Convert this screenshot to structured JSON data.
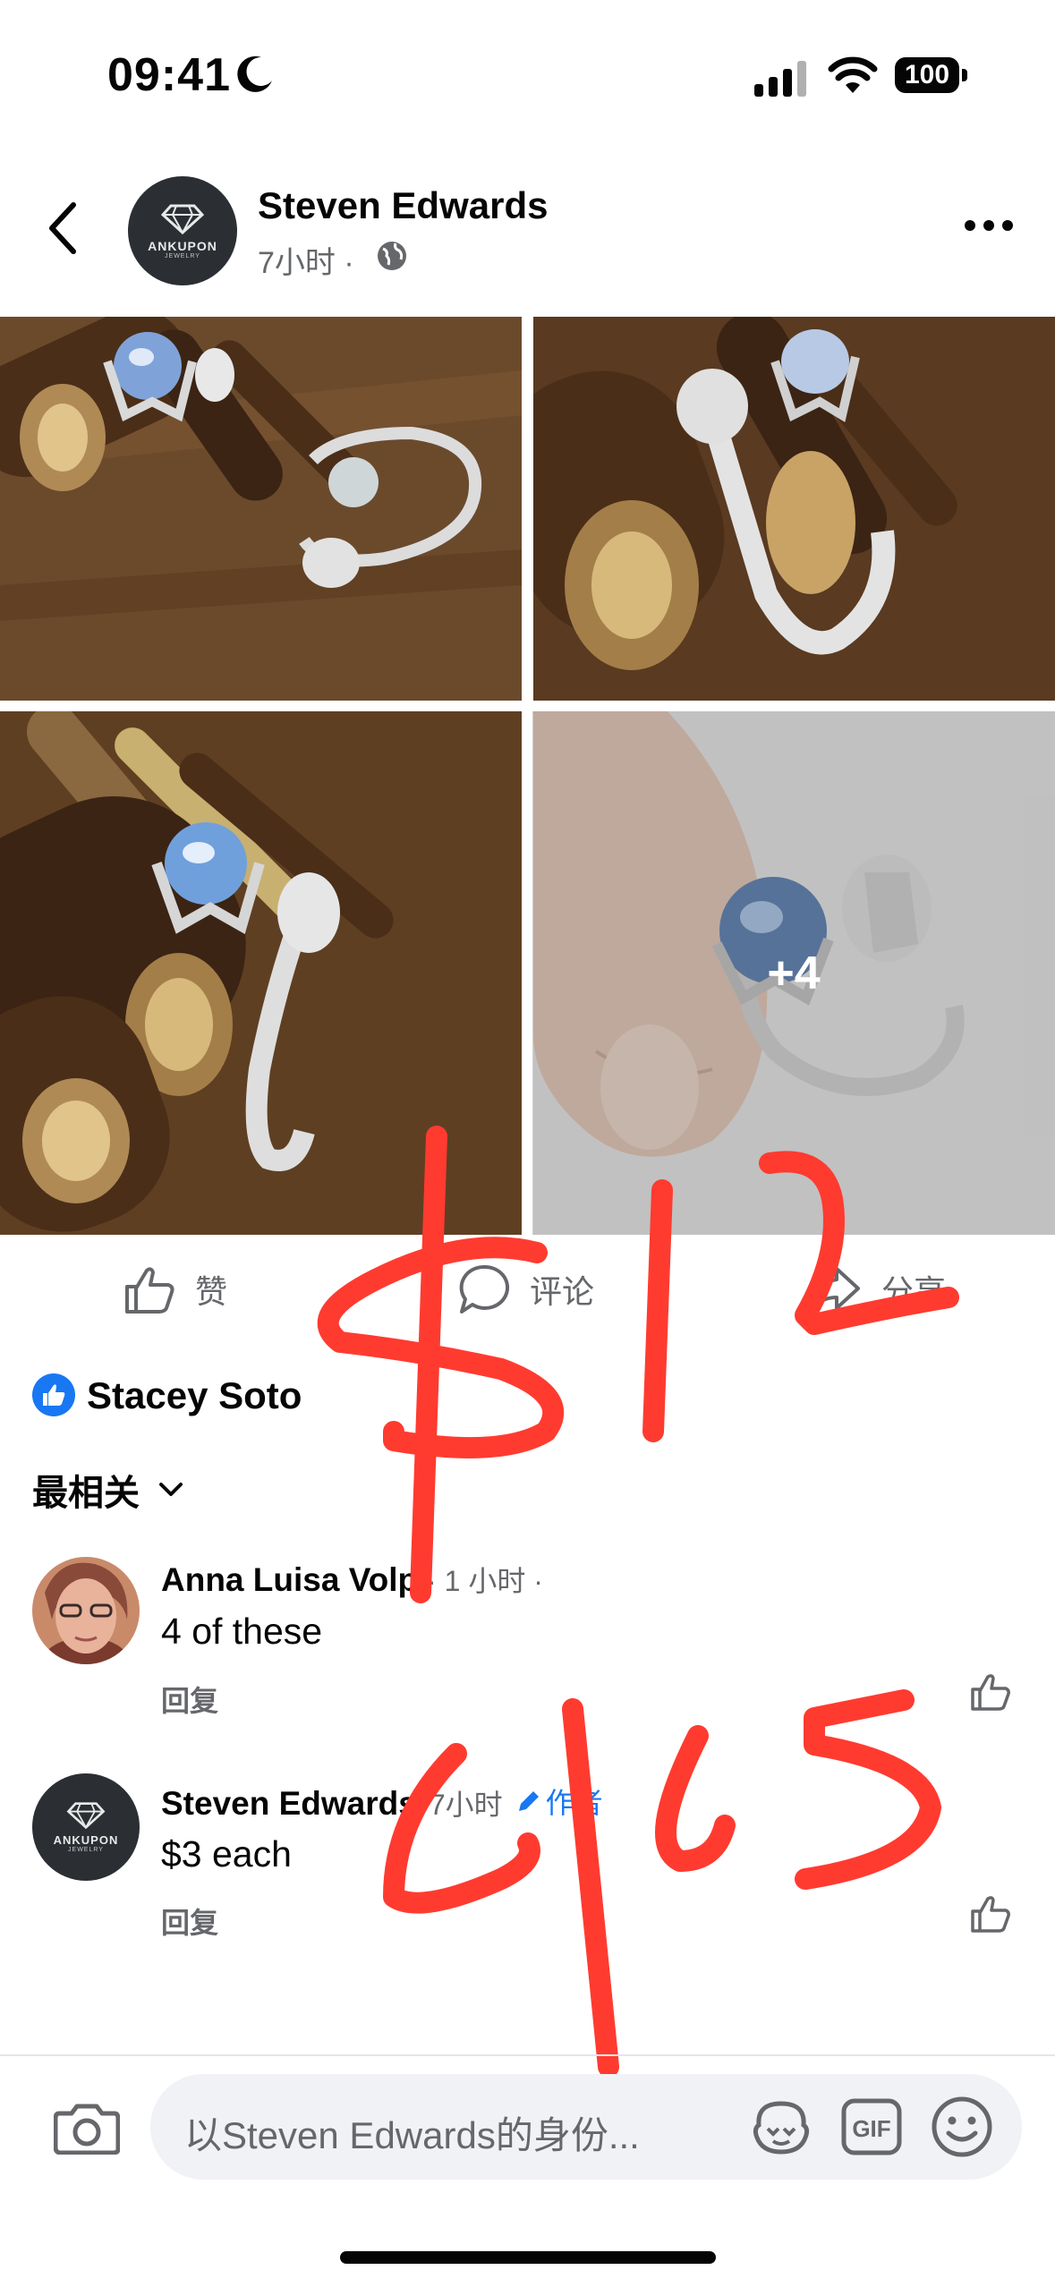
{
  "status_bar": {
    "time": "09:41",
    "battery": "100"
  },
  "post": {
    "author": "Steven Edwards",
    "avatar_brand": "ANKUPON",
    "avatar_sub": "JEWELRY",
    "time": "7小时",
    "separator": "·",
    "more_photos": "+4"
  },
  "actions": {
    "like": "赞",
    "comment": "评论",
    "share": "分享"
  },
  "reactions": {
    "name": "Stacey Soto"
  },
  "sort": {
    "label": "最相关"
  },
  "comments": [
    {
      "author": "Anna Luisa Volp",
      "time": "· 1 小时 ·",
      "text": "4 of these",
      "reply": "回复"
    },
    {
      "author": "Steven Edwards",
      "time": "7小时",
      "badge": "作者",
      "text": "$3 each",
      "reply": "回复"
    }
  ],
  "composer": {
    "placeholder": "以Steven Edwards的身份..."
  },
  "colors": {
    "facebook_blue": "#1877f2",
    "secondary_text": "#65676b",
    "scribble_red": "#ff3b30"
  }
}
